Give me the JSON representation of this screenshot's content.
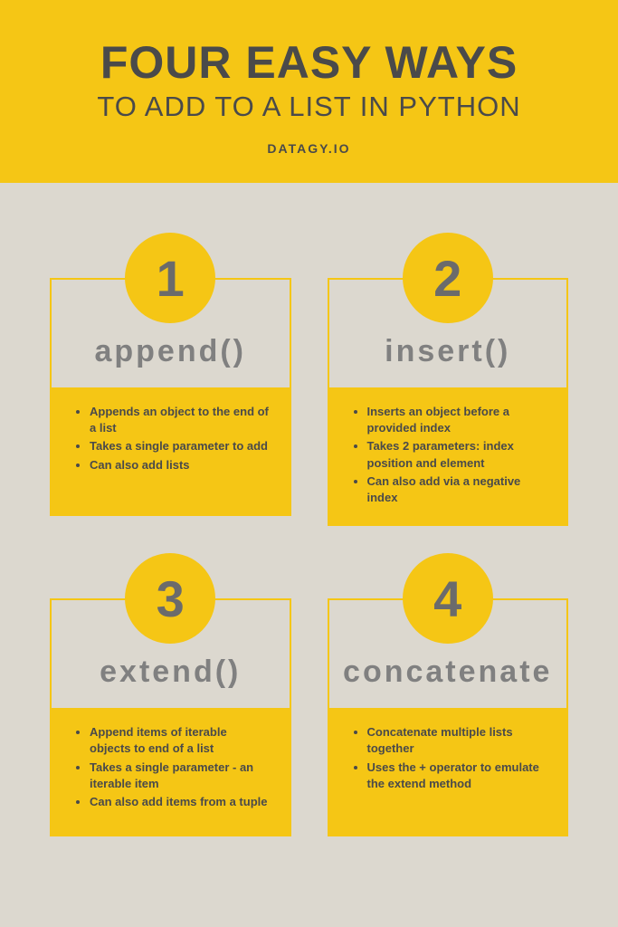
{
  "header": {
    "title": "FOUR EASY WAYS",
    "subtitle": "TO ADD TO A LIST IN PYTHON",
    "source": "DATAGY.IO"
  },
  "cards": [
    {
      "number": "1",
      "method": "append()",
      "bullets": [
        "Appends an object to the end of a list",
        "Takes a single parameter to add",
        "Can also add lists"
      ]
    },
    {
      "number": "2",
      "method": "insert()",
      "bullets": [
        "Inserts an object before a provided index",
        "Takes 2 parameters: index position and element",
        "Can also add via a negative index"
      ]
    },
    {
      "number": "3",
      "method": "extend()",
      "bullets": [
        "Append items of iterable objects to end of a list",
        "Takes a single parameter - an iterable item",
        "Can also add items from a tuple"
      ]
    },
    {
      "number": "4",
      "method": "concatenate",
      "bullets": [
        "Concatenate multiple lists together",
        "Uses the + operator to emulate the extend method"
      ]
    }
  ]
}
